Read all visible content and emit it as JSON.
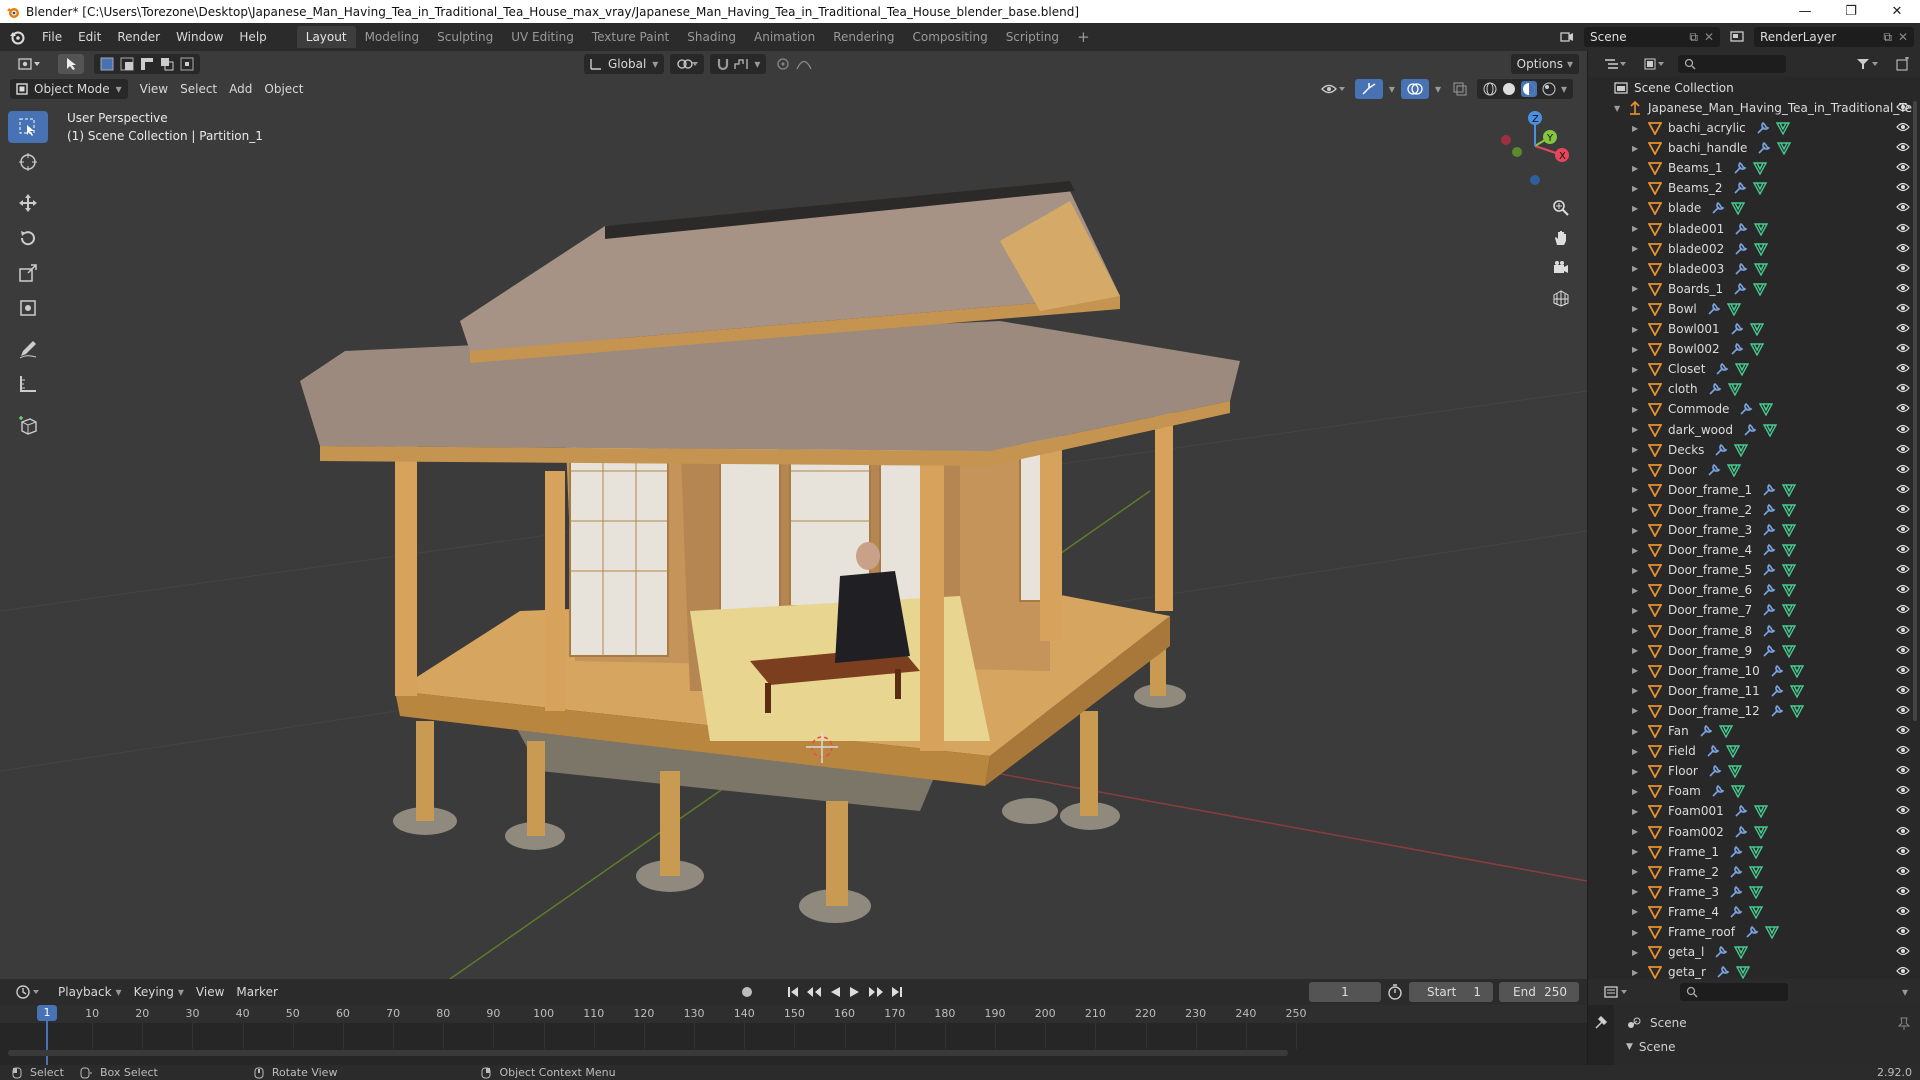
{
  "window": {
    "title": "Blender* [C:\\Users\\Torezone\\Desktop\\Japanese_Man_Having_Tea_in_Traditional_Tea_House_max_vray/Japanese_Man_Having_Tea_in_Traditional_Tea_House_blender_base.blend]",
    "icon": "blender-logo-icon"
  },
  "menu": [
    "File",
    "Edit",
    "Render",
    "Window",
    "Help"
  ],
  "workspaces": [
    "Layout",
    "Modeling",
    "Sculpting",
    "UV Editing",
    "Texture Paint",
    "Shading",
    "Animation",
    "Rendering",
    "Compositing",
    "Scripting"
  ],
  "active_workspace": "Layout",
  "scene_name": "Scene",
  "view_layer": "RenderLayer",
  "viewport": {
    "transform_orientation": "Global",
    "options_label": "Options",
    "mode": "Object Mode",
    "menus": [
      "View",
      "Select",
      "Add",
      "Object"
    ],
    "perspective_label": "User Perspective",
    "collection_label": "(1) Scene Collection | Partition_1",
    "gizmo_axes": [
      "X",
      "Y",
      "Z"
    ]
  },
  "outliner": {
    "root": "Scene Collection",
    "collection": "Japanese_Man_Having_Tea_in_Traditional_Te",
    "items": [
      "bachi_acrylic",
      "bachi_handle",
      "Beams_1",
      "Beams_2",
      "blade",
      "blade001",
      "blade002",
      "blade003",
      "Boards_1",
      "Bowl",
      "Bowl001",
      "Bowl002",
      "Closet",
      "cloth",
      "Commode",
      "dark_wood",
      "Decks",
      "Door",
      "Door_frame_1",
      "Door_frame_2",
      "Door_frame_3",
      "Door_frame_4",
      "Door_frame_5",
      "Door_frame_6",
      "Door_frame_7",
      "Door_frame_8",
      "Door_frame_9",
      "Door_frame_10",
      "Door_frame_11",
      "Door_frame_12",
      "Fan",
      "Field",
      "Floor",
      "Foam",
      "Foam001",
      "Foam002",
      "Frame_1",
      "Frame_2",
      "Frame_3",
      "Frame_4",
      "Frame_roof",
      "geta_l",
      "geta_r"
    ]
  },
  "timeline": {
    "menus": [
      "Playback",
      "Keying",
      "View",
      "Marker"
    ],
    "current_frame": "1",
    "start_label": "Start",
    "start": "1",
    "end_label": "End",
    "end": "250",
    "ticks": [
      "1",
      "10",
      "20",
      "30",
      "40",
      "50",
      "60",
      "70",
      "80",
      "90",
      "100",
      "110",
      "120",
      "130",
      "140",
      "150",
      "160",
      "170",
      "180",
      "190",
      "200",
      "210",
      "220",
      "230",
      "240",
      "250"
    ]
  },
  "properties": {
    "scene_label": "Scene",
    "section_label": "Scene"
  },
  "statusbar": {
    "select": "Select",
    "box_select": "Box Select",
    "rotate_view": "Rotate View",
    "context_menu": "Object Context Menu",
    "version": "2.92.0"
  },
  "colors": {
    "accent": "#4772b3",
    "object_icon": "#e8912e",
    "mesh_icon": "#46c98e",
    "modifier_icon": "#7ba3e0",
    "axis_x": "#e8475b",
    "axis_y": "#86c540",
    "axis_z": "#4a8fe0"
  }
}
